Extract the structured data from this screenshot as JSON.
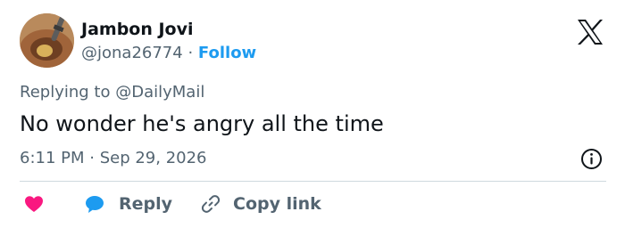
{
  "author": {
    "name": "Jambon Jovi",
    "handle": "@jona26774",
    "separator": "·",
    "follow_label": "Follow"
  },
  "tweet": {
    "replying_to_prefix": "Replying to",
    "replying_to_handle": "@DailyMail",
    "text": "No wonder he's angry all the time",
    "timestamp": "6:11 PM · Sep 29, 2026"
  },
  "actions": {
    "reply_label": "Reply",
    "copy_link_label": "Copy link"
  },
  "icons": {
    "brand": "x-logo-icon",
    "info": "info-icon",
    "like": "heart-icon",
    "reply": "speech-bubble-icon",
    "copy": "link-icon"
  },
  "colors": {
    "accent": "#1d9bf0",
    "heart": "#f91880",
    "muted_text": "#536471",
    "text": "#0f1419",
    "divider": "#cfd9de"
  }
}
